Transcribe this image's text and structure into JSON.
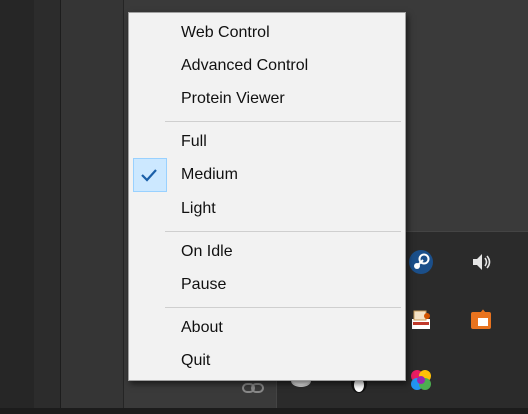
{
  "menu": {
    "groups": [
      {
        "items": [
          {
            "label": "Web Control",
            "checked": false
          },
          {
            "label": "Advanced Control",
            "checked": false
          },
          {
            "label": "Protein Viewer",
            "checked": false
          }
        ]
      },
      {
        "items": [
          {
            "label": "Full",
            "checked": false
          },
          {
            "label": "Medium",
            "checked": true
          },
          {
            "label": "Light",
            "checked": false
          }
        ]
      },
      {
        "items": [
          {
            "label": "On Idle",
            "checked": false
          },
          {
            "label": "Pause",
            "checked": false
          }
        ]
      },
      {
        "items": [
          {
            "label": "About",
            "checked": false
          },
          {
            "label": "Quit",
            "checked": false
          }
        ]
      }
    ]
  },
  "tray": {
    "icons": [
      "steam-icon",
      "speaker-icon",
      "pdf-printer-icon",
      "orange-app-icon",
      "drive-icon",
      "penguin-icon",
      "color-wheel-icon"
    ]
  },
  "colors": {
    "menu_bg": "#f2f2f2",
    "check_highlight": "#cce8ff",
    "check_color": "#1a5fa8"
  }
}
